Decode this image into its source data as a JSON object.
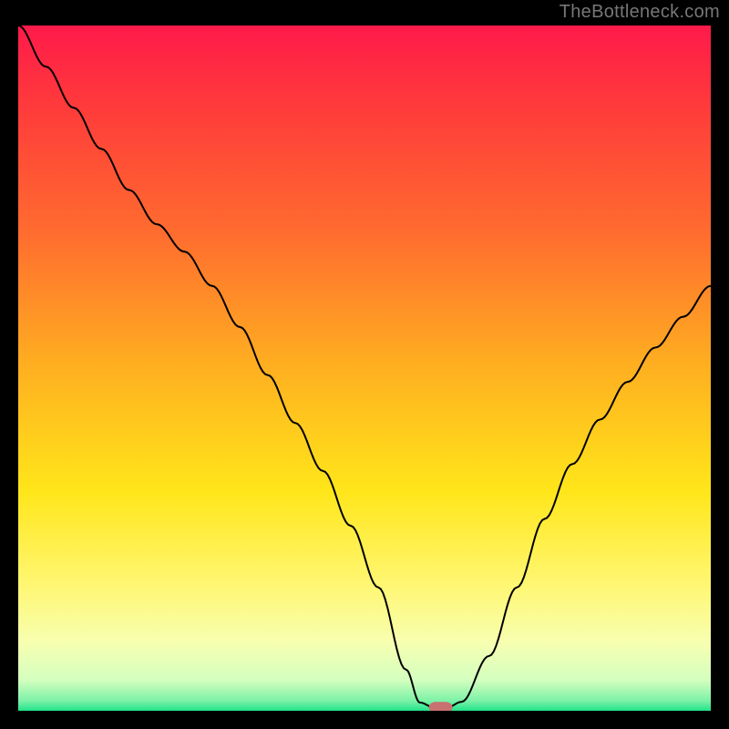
{
  "watermark": "TheBottleneck.com",
  "chart_data": {
    "type": "line",
    "title": "",
    "xlabel": "",
    "ylabel": "",
    "xlim": [
      0,
      100
    ],
    "ylim": [
      0,
      100
    ],
    "background_gradient": {
      "stops": [
        {
          "offset": 0.0,
          "color": "#ff1a4a"
        },
        {
          "offset": 0.12,
          "color": "#ff3b3b"
        },
        {
          "offset": 0.3,
          "color": "#ff6b2f"
        },
        {
          "offset": 0.5,
          "color": "#ffb020"
        },
        {
          "offset": 0.68,
          "color": "#ffe61a"
        },
        {
          "offset": 0.82,
          "color": "#fff775"
        },
        {
          "offset": 0.9,
          "color": "#f7ffb0"
        },
        {
          "offset": 0.955,
          "color": "#d4ffbf"
        },
        {
          "offset": 0.985,
          "color": "#7ef2a8"
        },
        {
          "offset": 1.0,
          "color": "#20e38a"
        }
      ]
    },
    "series": [
      {
        "name": "bottleneck-curve",
        "color": "#000000",
        "width": 2,
        "x": [
          0,
          4,
          8,
          12,
          16,
          20,
          24,
          28,
          32,
          36,
          40,
          44,
          48,
          52,
          56,
          58,
          60,
          62,
          64,
          68,
          72,
          76,
          80,
          84,
          88,
          92,
          96,
          100
        ],
        "y": [
          100,
          94,
          88,
          82,
          76,
          71,
          67,
          62,
          56,
          49,
          42,
          35,
          27,
          18,
          6,
          1.2,
          0.5,
          0.5,
          1.3,
          8,
          18,
          28,
          36,
          42.5,
          48,
          53,
          57.5,
          62
        ]
      }
    ],
    "marker": {
      "name": "min-marker",
      "shape": "rounded-rect",
      "cx": 61,
      "cy": 0.5,
      "w": 3.4,
      "h": 1.6,
      "rx": 1.0,
      "fill": "#c97071"
    }
  }
}
